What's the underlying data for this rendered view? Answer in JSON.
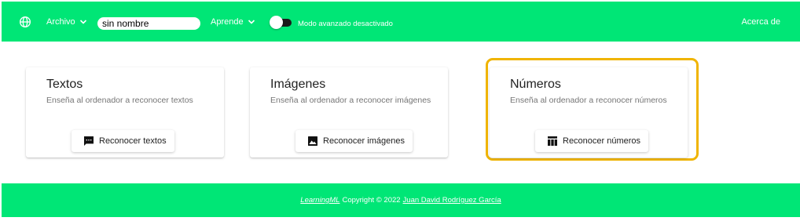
{
  "header": {
    "menu_file": "Archivo",
    "project_name": "sin nombre",
    "menu_learn": "Aprende",
    "advanced_mode_label": "Modo avanzado desactivado",
    "advanced_mode_on": false,
    "about": "Acerca de"
  },
  "cards": [
    {
      "title": "Textos",
      "subtitle": "Enseña al ordenador a reconocer textos",
      "button": "Reconocer textos",
      "icon": "comment-icon"
    },
    {
      "title": "Imágenes",
      "subtitle": "Enseña al ordenador a reconocer imágenes",
      "button": "Reconocer imágenes",
      "icon": "image-icon"
    },
    {
      "title": "Números",
      "subtitle": "Enseña al ordenador a reconocer números",
      "button": "Reconocer números",
      "icon": "table-icon"
    }
  ],
  "footer": {
    "brand": "LearningML",
    "copyright": "Copyright © 2022",
    "author": "Juan David Rodríguez García"
  },
  "colors": {
    "brand_green": "#00e676",
    "focus_yellow": "#f0b400"
  }
}
